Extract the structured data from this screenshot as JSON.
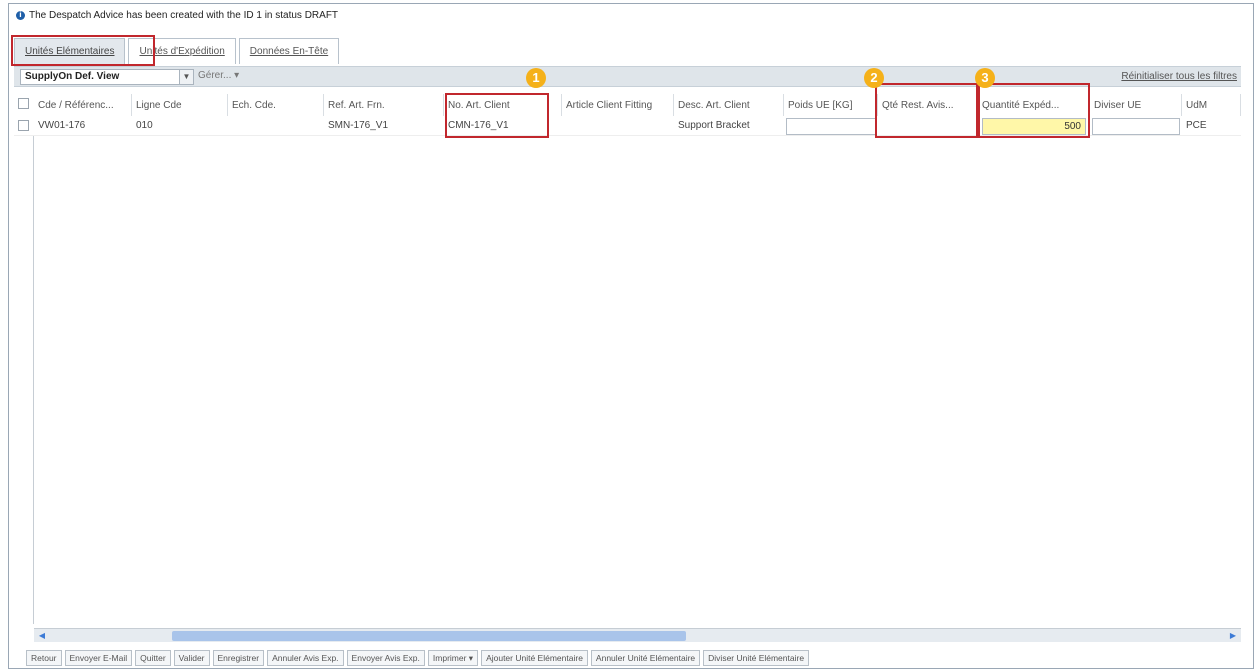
{
  "info": {
    "message": "The Despatch Advice has been created with the ID 1 in status DRAFT"
  },
  "tabs": [
    {
      "label": "Unités Elémentaires"
    },
    {
      "label": "Unités d'Expédition"
    },
    {
      "label": "Données En-Tête"
    }
  ],
  "toolbar": {
    "view_selected": "SupplyOn Def. View",
    "manage_label": "Gérer... ▾",
    "reset_filters": "Réinitialiser tous les filtres"
  },
  "columns": [
    "Cde / Référenc...",
    "Ligne Cde",
    "Ech. Cde.",
    "Ref. Art. Frn.",
    "No. Art. Client",
    "Article Client Fitting",
    "Desc. Art. Client",
    "Poids UE [KG]",
    "Qté Rest. Avis...",
    "Quantité Expéd...",
    "Diviser UE",
    "UdM"
  ],
  "rows": [
    {
      "order_ref": "VW01-176",
      "order_line": "010",
      "due": "",
      "supplier_part": "SMN-176_V1",
      "customer_part": "CMN-176_V1",
      "fitting": "",
      "description": "Support Bracket",
      "weight": "",
      "remaining_qty": "",
      "shipped_qty": "500",
      "split": "",
      "uom": "PCE"
    }
  ],
  "badges": [
    "1",
    "2",
    "3"
  ],
  "bottom_buttons": [
    "Retour",
    "Envoyer E-Mail",
    "Quitter",
    "Valider",
    "Enregistrer",
    "Annuler Avis Exp.",
    "Envoyer Avis Exp.",
    "Imprimer ▾",
    "Ajouter Unité Elémentaire",
    "Annuler Unité Elémentaire",
    "Diviser Unité Elémentaire"
  ],
  "colors": {
    "highlight": "#c1272d",
    "badge": "#f5b11a",
    "yellow_input": "#fff7a8"
  }
}
